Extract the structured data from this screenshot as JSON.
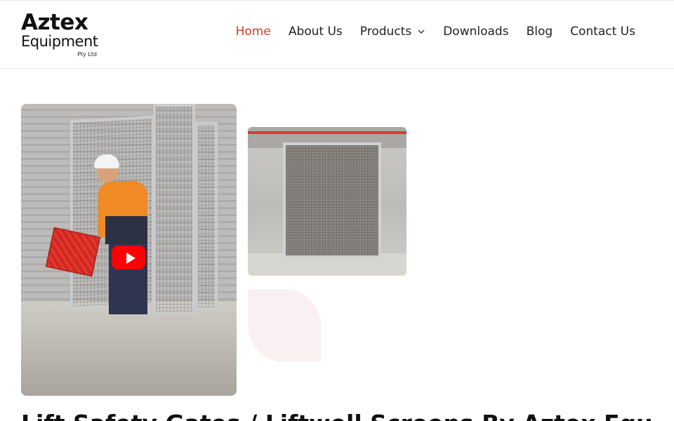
{
  "brand": {
    "logo_main": "Aztex",
    "logo_sub": "Equipment",
    "logo_legal": "Pty Ltd"
  },
  "nav": {
    "items": [
      {
        "label": "Home",
        "active": true
      },
      {
        "label": "About Us",
        "active": false
      },
      {
        "label": "Products",
        "active": false,
        "has_dropdown": true
      },
      {
        "label": "Downloads",
        "active": false
      },
      {
        "label": "Blog",
        "active": false
      },
      {
        "label": "Contact Us",
        "active": false
      }
    ],
    "active_color": "#d83b25"
  },
  "media": {
    "video_thumbnail": "worker-carrying-crate-through-safety-cage",
    "video_play_icon": "youtube-play-icon",
    "gallery_image": "lift-safety-gate-cage-installed"
  },
  "main": {
    "heading": "Lift Safety Gates / Liftwell Screens By Aztex Equipment"
  }
}
